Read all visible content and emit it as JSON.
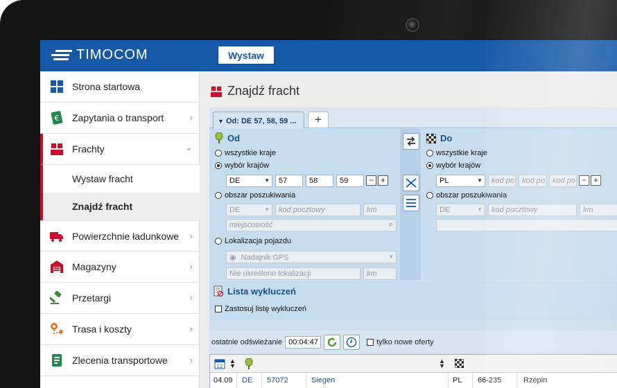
{
  "brand": {
    "name": "TIMOCOM"
  },
  "topbar": {
    "publish_button": "Wystaw"
  },
  "sidebar": {
    "items": [
      {
        "label": "Strona startowa",
        "icon": "dashboard-icon"
      },
      {
        "label": "Zapytania o transport",
        "icon": "euro-request-icon"
      },
      {
        "label": "Frachty",
        "icon": "freight-boxes-icon"
      },
      {
        "label": "Powierzchnie ładunkowe",
        "icon": "truck-icon"
      },
      {
        "label": "Magazyny",
        "icon": "warehouse-icon"
      },
      {
        "label": "Przetargi",
        "icon": "gavel-icon"
      },
      {
        "label": "Trasa i koszty",
        "icon": "route-icon"
      },
      {
        "label": "Zlecenia transportowe",
        "icon": "order-document-icon"
      }
    ],
    "subitems": [
      {
        "label": "Wystaw fracht"
      },
      {
        "label": "Znajdź fracht"
      }
    ],
    "accent": "#c8102e"
  },
  "page": {
    "title": "Znajdź fracht"
  },
  "tabs": [
    {
      "label": "Od: DE 57, 58, 59 ..."
    }
  ],
  "from": {
    "header": "Od",
    "all_countries": "wszystkie kraje",
    "country_select": "wybór krajów",
    "country": "DE",
    "zips": [
      "57",
      "58",
      "59"
    ],
    "search_area": "obszar poszukiwania",
    "area_country": "DE",
    "zip_placeholder": "kod pocztowy",
    "km_placeholder": "km",
    "city_placeholder": "miejscowość",
    "vehicle_location": "Lokalizacja pojazdu",
    "gps": "Nadajnik GPS",
    "location_status": "Nie określono lokalizacji",
    "gps_km_placeholder": "km"
  },
  "to": {
    "header": "Do",
    "all_countries": "wszystkie kraje",
    "country_select": "wybór krajów",
    "country": "PL",
    "zip_placeholders": [
      "kod po",
      "kod po",
      "kod po"
    ],
    "search_area": "obszar poszukiwania",
    "area_country": "DE",
    "zip_placeholder": "kod pocztowy",
    "km_placeholder": "km"
  },
  "exclusion": {
    "title": "Lista wykluczeń",
    "apply": "Zastosuj listę wykluczeń"
  },
  "status": {
    "refresh_label": "ostatnie odświeżanie",
    "refresh_time": "00:04:47",
    "new_only": "tylko nowe oferty"
  },
  "grid": {
    "calendar_day": "12",
    "row": {
      "date": "04.09",
      "from_country": "DE",
      "from_zip": "57072",
      "from_city": "Siegen",
      "to_country": "PL",
      "to_zip": "66-235",
      "to_city": "Rzepin"
    }
  },
  "colors": {
    "primary": "#1659a8",
    "panel": "#c6dcef",
    "from_marker": "#7fa82e"
  }
}
